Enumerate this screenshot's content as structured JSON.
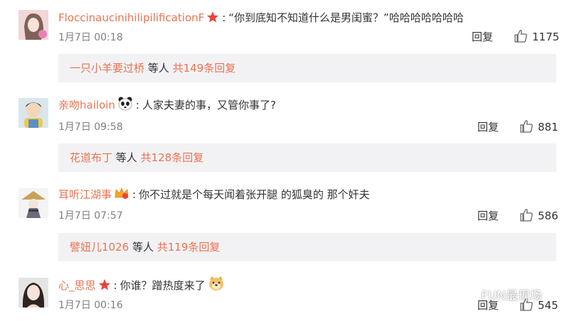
{
  "comments": [
    {
      "username": "FloccinaucinihilipilificationF",
      "badge": "star-badge",
      "text": "“你到底知不知道什么是男闺蜜？”哈哈哈哈哈哈哈",
      "time": "1月7日 00:18",
      "reply_label": "回复",
      "likes": "1175",
      "sub_user": "一只小羊要过桥",
      "sub_mid": "等人",
      "sub_more": "共149条回复"
    },
    {
      "username": "亲吻hailoin",
      "badge": "panda-badge",
      "text": "人家夫妻的事，又管你事了?",
      "time": "1月7日 09:58",
      "reply_label": "回复",
      "likes": "881",
      "sub_user": "花道布丁",
      "sub_mid": "等人",
      "sub_more": "共128条回复"
    },
    {
      "username": "耳听江湖事",
      "badge": "crown-badge",
      "text": "你不过就是个每天闻着张开腿 的狐臭的 那个奸夫",
      "time": "1月7日 07:57",
      "reply_label": "回复",
      "likes": "586",
      "sub_user": "譬妞儿1026",
      "sub_mid": "等人",
      "sub_more": "共119条回复"
    },
    {
      "username": "心_思思",
      "badge": "star-badge",
      "text": "你谁？蹭热度来了",
      "emoji": "doge-emoji",
      "time": "1月7日 00:16",
      "reply_label": "回复",
      "likes": "545"
    }
  ],
  "watermark": "FUN最现场",
  "colors": {
    "username": "#eb7350",
    "subbox_bg": "#f2f2f5",
    "meta": "#808080"
  }
}
